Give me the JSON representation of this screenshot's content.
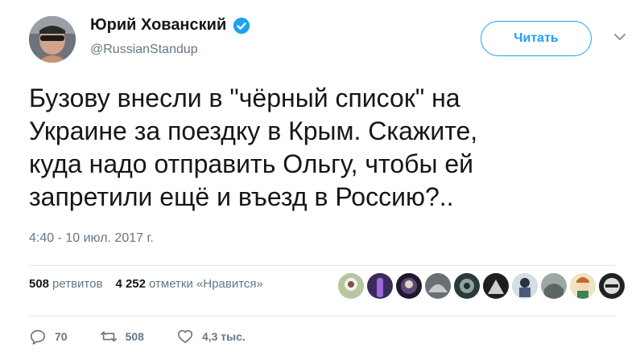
{
  "author": {
    "name": "Юрий Хованский",
    "handle": "@RussianStandup"
  },
  "follow_button_label": "Читать",
  "tweet": {
    "text": "Бузову внесли в \"чёрный список\" на\nУкраине за поездку в Крым. Скажите,\nкуда надо отправить Ольгу, чтобы ей\nзапретили ещё и въезд в Россию?..",
    "timestamp": "4:40 - 10 июл. 2017 г."
  },
  "stats": {
    "retweets_count": "508",
    "retweets_label": "ретвитов",
    "likes_count": "4 252",
    "likes_label": "отметки «Нравится»"
  },
  "actions": {
    "replies": "70",
    "retweets": "508",
    "likes": "4,3 тыс."
  },
  "colors": {
    "accent": "#1da1f2",
    "secondary_text": "#657786",
    "primary_text": "#14171a",
    "divider": "#e1e8ed"
  }
}
